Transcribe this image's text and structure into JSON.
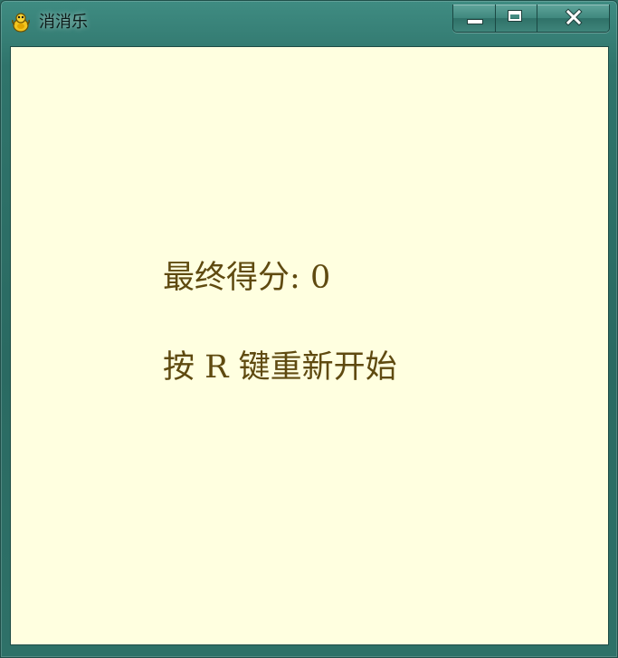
{
  "window": {
    "title": "消消乐",
    "icon": "pygame-snake-icon"
  },
  "caption_buttons": {
    "minimize": "minimize-icon",
    "maximize": "maximize-icon",
    "close": "close-icon"
  },
  "game_over": {
    "score_label": "最终得分:",
    "score_value": "0",
    "restart_hint": "按 R 键重新开始"
  },
  "colors": {
    "background": "#ffffe0",
    "text": "#5f4a10",
    "frame": "#2f746b"
  }
}
